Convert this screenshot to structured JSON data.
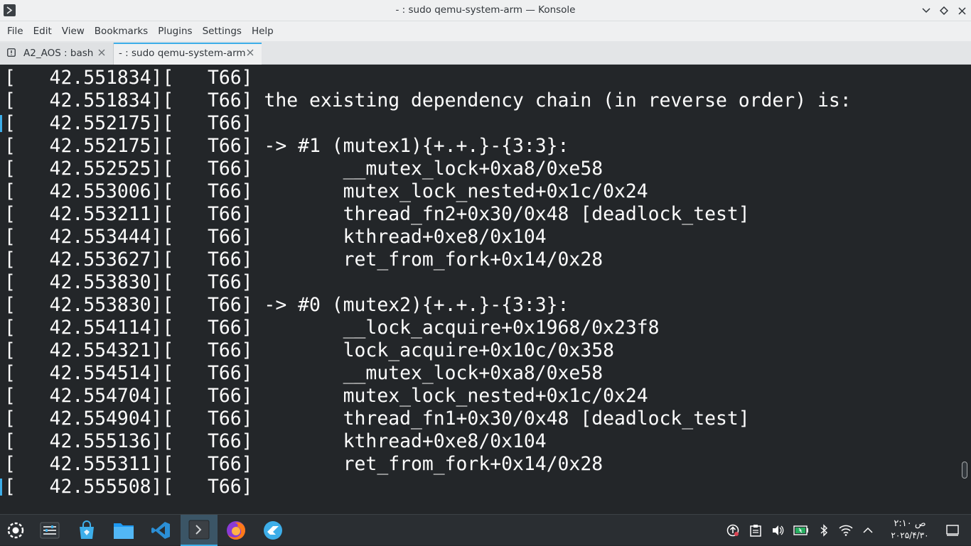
{
  "window": {
    "title": "- : sudo qemu-system-arm — Konsole"
  },
  "menu": [
    "File",
    "Edit",
    "View",
    "Bookmarks",
    "Plugins",
    "Settings",
    "Help"
  ],
  "tabs": [
    {
      "label": "A2_AOS : bash",
      "active": false
    },
    {
      "label": "- : sudo qemu-system-arm",
      "active": true
    }
  ],
  "terminal_lines": [
    "[   42.551834][   T66]",
    "[   42.551834][   T66] the existing dependency chain (in reverse order) is:",
    "[   42.552175][   T66]",
    "[   42.552175][   T66] -> #1 (mutex1){+.+.}-{3:3}:",
    "[   42.552525][   T66]        __mutex_lock+0xa8/0xe58",
    "[   42.553006][   T66]        mutex_lock_nested+0x1c/0x24",
    "[   42.553211][   T66]        thread_fn2+0x30/0x48 [deadlock_test]",
    "[   42.553444][   T66]        kthread+0xe8/0x104",
    "[   42.553627][   T66]        ret_from_fork+0x14/0x28",
    "[   42.553830][   T66]",
    "[   42.553830][   T66] -> #0 (mutex2){+.+.}-{3:3}:",
    "[   42.554114][   T66]        __lock_acquire+0x1968/0x23f8",
    "[   42.554321][   T66]        lock_acquire+0x10c/0x358",
    "[   42.554514][   T66]        __mutex_lock+0xa8/0xe58",
    "[   42.554704][   T66]        mutex_lock_nested+0x1c/0x24",
    "[   42.554904][   T66]        thread_fn1+0x30/0x48 [deadlock_test]",
    "[   42.555136][   T66]        kthread+0xe8/0x104",
    "[   42.555311][   T66]        ret_from_fork+0x14/0x28",
    "[   42.555508][   T66]"
  ],
  "taskbar": {
    "apps": [
      {
        "name": "application-launcher-icon",
        "active": false
      },
      {
        "name": "system-settings-icon",
        "active": false
      },
      {
        "name": "discover-store-icon",
        "active": false
      },
      {
        "name": "dolphin-files-icon",
        "active": false
      },
      {
        "name": "vscode-icon",
        "active": false
      },
      {
        "name": "konsole-icon",
        "active": true
      },
      {
        "name": "firefox-icon",
        "active": false
      },
      {
        "name": "ktorrent-icon",
        "active": false
      }
    ],
    "clock": {
      "time": "۲:۱۰ ص",
      "date": "۲۰۲۵/۴/۳۰"
    }
  },
  "colors": {
    "terminal_bg": "#232629",
    "terminal_fg": "#fcfcfc",
    "accent": "#3daee9",
    "chrome": "#eff0f1"
  }
}
